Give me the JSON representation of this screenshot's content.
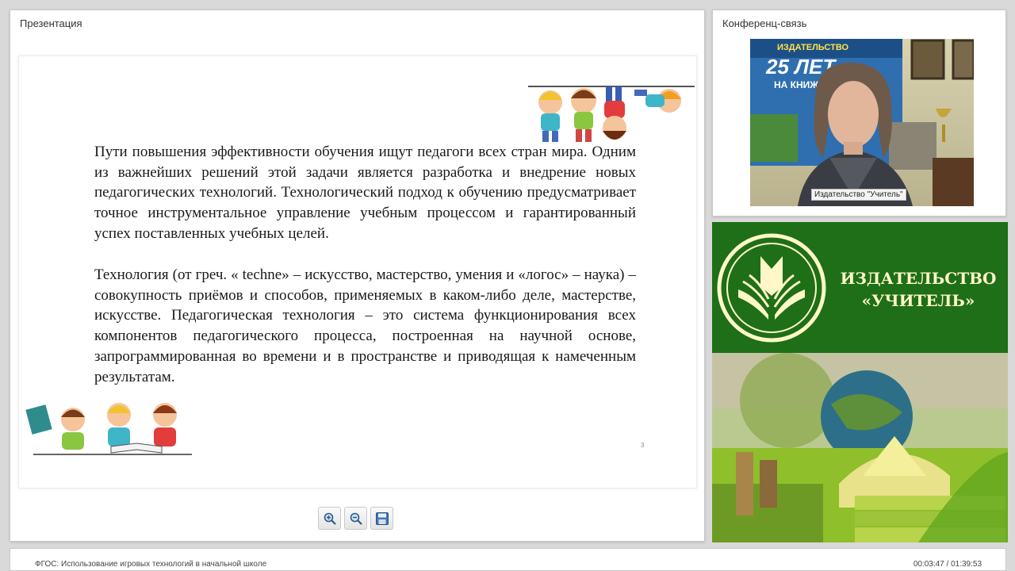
{
  "presentation": {
    "title": "Презентация",
    "slide": {
      "paragraph_1": "Пути повышения эффективности обучения ищут педагоги всех стран мира. Одним из важнейших решений этой задачи является разработка и внедрение новых педагогических технологий. Технологический подход к обучению предусматривает точное инструментальное управление учебным процессом и гарантированный успех поставленных учебных целей.",
      "paragraph_2": "Технология (от греч. « techne» – искусство, мастерство, умения и «логос» – наука) – совокупность приёмов и способов, применяемых в каком-либо деле, мастерстве, искусстве. Педагогическая технология – это система функционирования всех компонентов педагогического процесса, построенная на научной основе, запрограммированная во времени и в пространстве и приводящая к намеченным результатам.",
      "page_number": "3"
    },
    "toolbar": {
      "zoom_in_icon": "zoom-in-icon",
      "zoom_out_icon": "zoom-out-icon",
      "save_icon": "save-icon"
    }
  },
  "conference": {
    "title": "Конференц-связь",
    "video_label": "Издательство \"Учитель\"",
    "backdrop_text_1": "ИЗДАТЕЛЬСТВО",
    "backdrop_text_2": "25 ЛЕТ",
    "backdrop_text_3": "НА КНИЖН"
  },
  "banner": {
    "name_line_1": "ИЗДАТЕЛЬСТВО",
    "name_line_2": "«УЧИТЕЛЬ»"
  },
  "status": {
    "webinar_title": "ФГОС: Использование игровых технологий в начальной школе",
    "time": "00:03:47 / 01:39:53"
  },
  "colors": {
    "banner_green": "#1f6b18",
    "banner_text": "#fff7c8",
    "panel_bg": "#ffffff",
    "page_bg": "#d9d9d9"
  }
}
